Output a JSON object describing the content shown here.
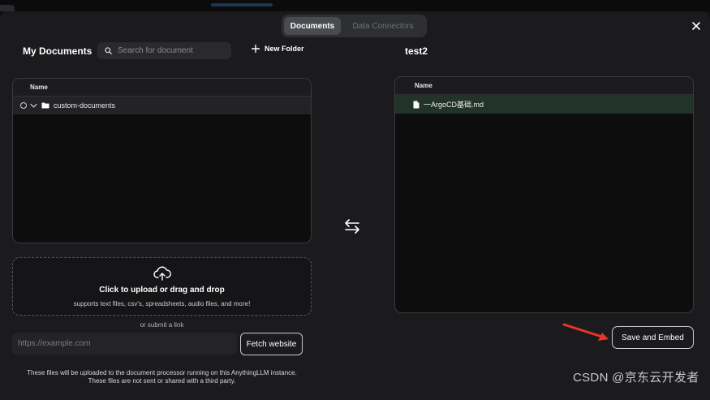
{
  "tabs": [
    {
      "label": "Documents",
      "active": true
    },
    {
      "label": "Data Connectors",
      "active": false
    }
  ],
  "left": {
    "title": "My Documents",
    "search_placeholder": "Search for document",
    "new_folder_label": "New Folder",
    "column_header": "Name",
    "folders": [
      {
        "name": "custom-documents",
        "expanded": true
      }
    ]
  },
  "right": {
    "title": "test2",
    "column_header": "Name",
    "files": [
      {
        "name": "一ArgoCD基础.md"
      }
    ]
  },
  "upload": {
    "main_text": "Click to upload or drag and drop",
    "sub_text": "supports text files, csv's, spreadsheets, audio files, and more!"
  },
  "link": {
    "or_text": "or submit a link",
    "placeholder": "https://example.com",
    "fetch_label": "Fetch website"
  },
  "disclaimer": {
    "line1": "These files will be uploaded to the document processor running on this AnythingLLM instance.",
    "line2": "These files are not sent or shared with a third party."
  },
  "save_label": "Save and Embed",
  "watermark": "CSDN @京东云开发者",
  "colors": {
    "modal_bg": "#1b1b1e",
    "panel_bg": "#0d0d0e",
    "selected_row": "#22332a",
    "annotation_arrow": "#e8352a"
  },
  "icons": [
    "close-icon",
    "search-icon",
    "plus-icon",
    "chevron-down-icon",
    "folder-icon",
    "file-icon",
    "swap-arrows-icon",
    "cloud-upload-icon",
    "annotation-arrow"
  ]
}
